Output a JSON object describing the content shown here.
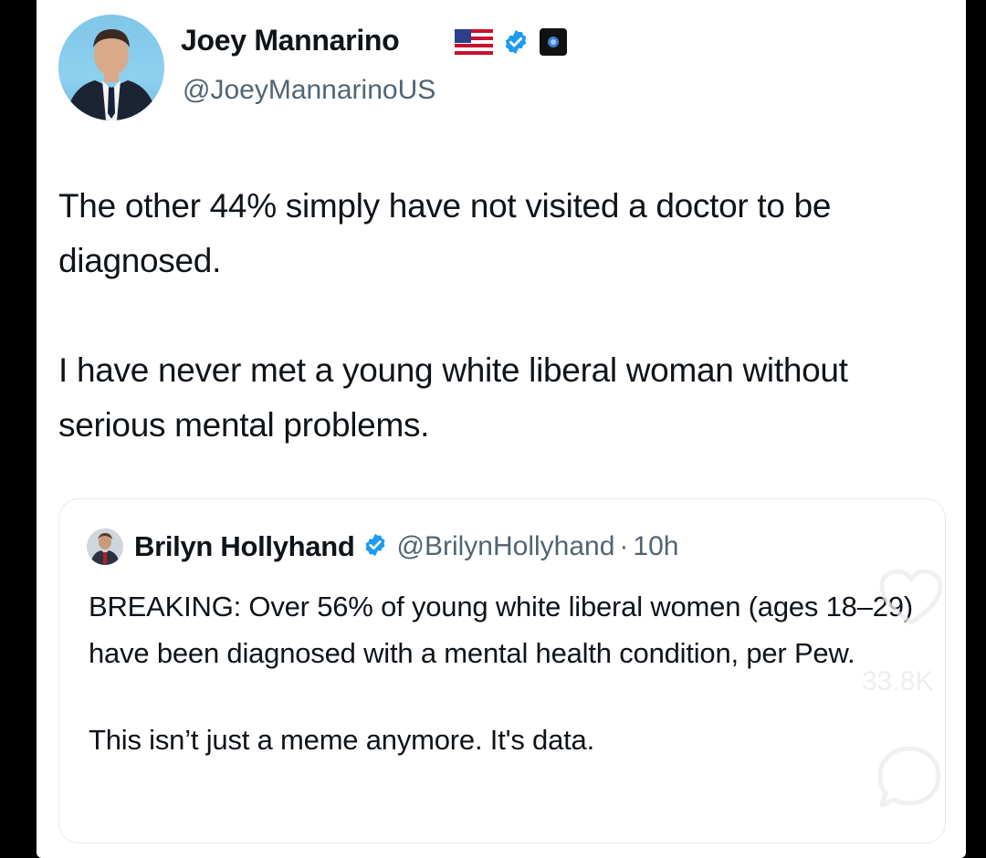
{
  "tweet": {
    "author": {
      "name": "Joey Mannarino",
      "handle": "@JoeyMannarinoUS",
      "badges": [
        "us-flag-icon",
        "verified-icon",
        "affiliate-badge-icon"
      ]
    },
    "text": [
      "The other 44% simply have not visited a doctor to be diagnosed.",
      "I have never met a young white liberal woman without serious mental problems."
    ]
  },
  "quote": {
    "author": {
      "name": "Brilyn Hollyhand",
      "handle": "@BrilynHollyhand",
      "separator": "·",
      "time": "10h"
    },
    "text": [
      "BREAKING: Over 56% of young white liberal women (ages 18–29) have been diagnosed with a mental health condition, per Pew.",
      "This isn’t just a meme anymore. It's data."
    ]
  },
  "overlay": {
    "like_count": "33.8K",
    "icons": [
      "heart-icon",
      "comment-icon"
    ]
  },
  "colors": {
    "verified": "#1d9bf0",
    "text": "#0f1419",
    "secondary": "#536471"
  }
}
